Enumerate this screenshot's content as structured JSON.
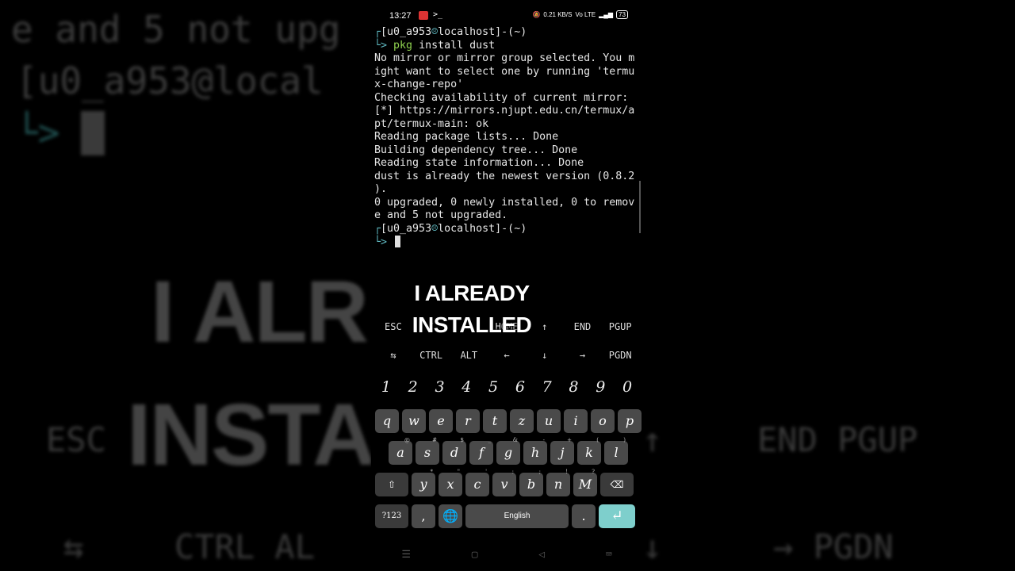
{
  "statusbar": {
    "time": "13:27",
    "app_icon": "video-record-icon",
    "terminal_icon": ">_",
    "network_speed": "0.21 KB/S",
    "signal": "Vo LTE",
    "battery": "73"
  },
  "terminal": {
    "prompt_user": "u0_a953",
    "prompt_at": "☹",
    "prompt_host": "localhost",
    "prompt_dir": "~",
    "command": "pkg install dust",
    "output_lines": [
      "No mirror or mirror group selected. You m",
      "ight want to select one by running 'termu",
      "x-change-repo'",
      "Checking availability of current mirror:",
      "[*] https://mirrors.njupt.edu.cn/termux/a",
      "pt/termux-main: ok",
      "Reading package lists... Done",
      "Building dependency tree... Done",
      "Reading state information... Done",
      "dust is already the newest version (0.8.2",
      ").",
      "0 upgraded, 0 newly installed, 0 to remov",
      "e and 5 not upgraded."
    ]
  },
  "caption": {
    "line1": "I ALREADY",
    "line2": "INSTALLED"
  },
  "extra_keys": {
    "row1": [
      "ESC",
      "/",
      "-",
      "HOME",
      "↑",
      "END",
      "PGUP"
    ],
    "row2": [
      "⇆",
      "CTRL",
      "ALT",
      "←",
      "↓",
      "→",
      "PGDN"
    ]
  },
  "keyboard": {
    "numbers": [
      "1",
      "2",
      "3",
      "4",
      "5",
      "6",
      "7",
      "8",
      "9",
      "0"
    ],
    "row1": [
      "q",
      "w",
      "e",
      "r",
      "t",
      "z",
      "u",
      "i",
      "o",
      "p"
    ],
    "row2": [
      "a",
      "s",
      "d",
      "f",
      "g",
      "h",
      "j",
      "k",
      "l"
    ],
    "row2_hints": [
      "@",
      "#",
      "$",
      "_",
      "&",
      "-",
      "+",
      "(",
      ")"
    ],
    "row3": [
      "y",
      "x",
      "c",
      "v",
      "b",
      "n",
      "M"
    ],
    "row3_hints": [
      "*",
      "\"",
      "'",
      ":",
      ";",
      "!",
      "?"
    ],
    "symbols_key": "?123",
    "comma_key": ",",
    "period_key": ".",
    "space_label": "English",
    "shift_icon": "shift-arrow-icon",
    "backspace_icon": "backspace-icon",
    "globe_icon": "globe-icon",
    "enter_icon": "enter-arrow-icon"
  },
  "bg": {
    "line_top": "e and 5 not upg",
    "prompt": "[u0_a953@local",
    "caption_left_1": "I ALR",
    "caption_left_2": "INSTA",
    "keys_left_1": "ESC",
    "keys_left_2": "CTRL  AL",
    "keys_right_1": "END    PGUP",
    "keys_right_2": "→      PGDN"
  }
}
